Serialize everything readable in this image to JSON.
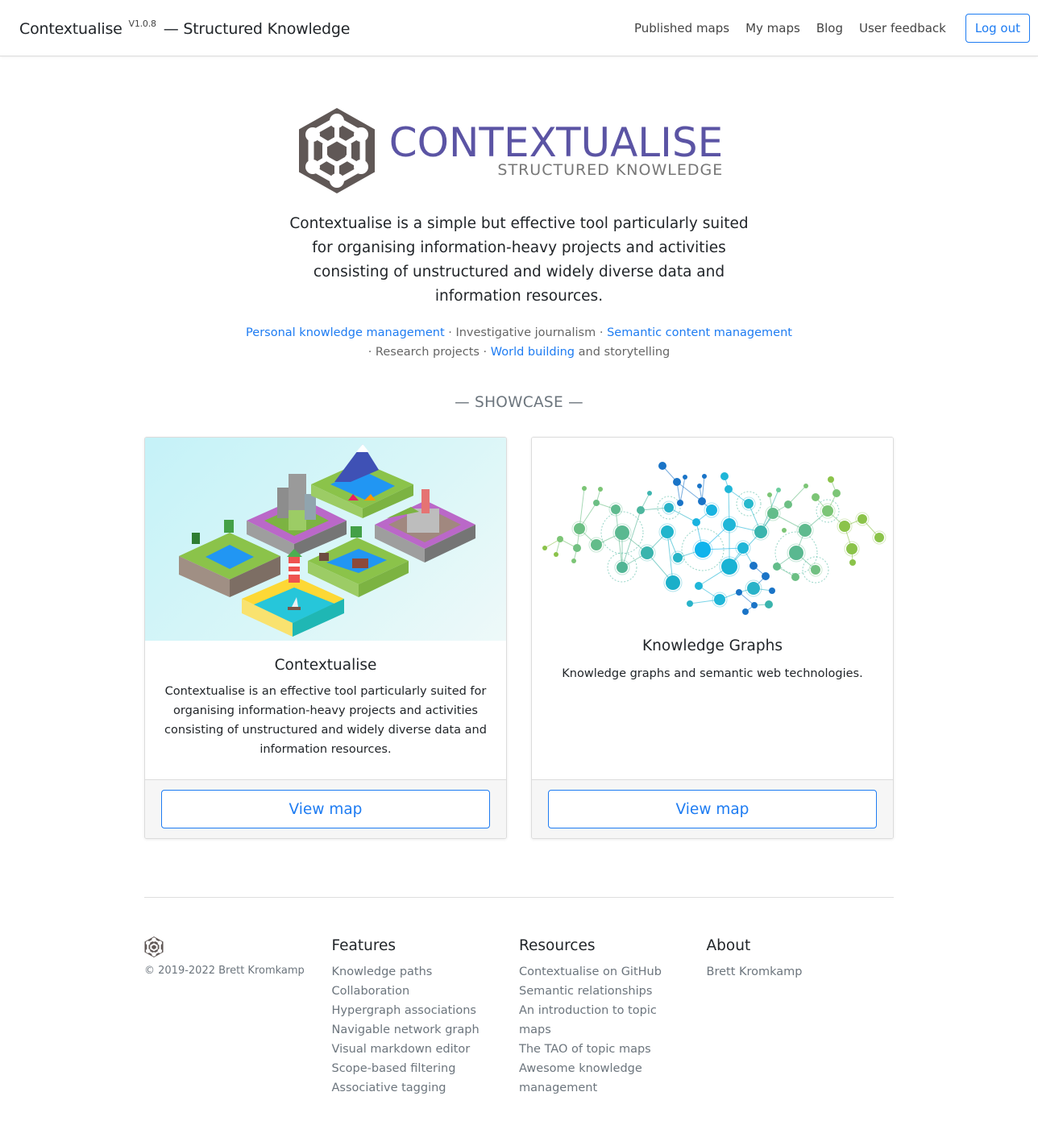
{
  "navbar": {
    "brand_name": "Contextualise",
    "version": "V1.0.8",
    "brand_tagline": "— Structured Knowledge",
    "links": [
      "Published maps",
      "My maps",
      "Blog",
      "User feedback"
    ],
    "logout_label": "Log out"
  },
  "hero": {
    "logo_main": "CONTEXTUALISE",
    "logo_sub": "STRUCTURED KNOWLEDGE",
    "lead": "Contextualise is a simple but effective tool particularly suited for organising information-heavy projects and activities consisting of unstructured and widely diverse data and information resources.",
    "tags": {
      "t1": "Personal knowledge management",
      "s1": " · Investigative journalism · ",
      "t2": "Semantic content management",
      "s2": " · Research projects · ",
      "t3": "World building",
      "s3": " and storytelling"
    },
    "showcase_title": "— SHOWCASE —"
  },
  "cards": [
    {
      "image": "isometric-world-illustration",
      "title": "Contextualise",
      "text": "Contextualise is an effective tool particularly suited for organising information-heavy projects and activities consisting of unstructured and widely diverse data and information resources.",
      "button": "View map"
    },
    {
      "image": "network-graph-illustration",
      "title": "Knowledge Graphs",
      "text": "Knowledge graphs and semantic web technologies.",
      "button": "View map"
    }
  ],
  "footer": {
    "copyright": "© 2019-2022 Brett Kromkamp",
    "features": {
      "heading": "Features",
      "items": [
        "Knowledge paths",
        "Collaboration",
        "Hypergraph associations",
        "Navigable network graph",
        "Visual markdown editor",
        "Scope-based filtering",
        "Associative tagging"
      ]
    },
    "resources": {
      "heading": "Resources",
      "items": [
        "Contextualise on GitHub",
        "Semantic relationships",
        "An introduction to topic maps",
        "The TAO of topic maps",
        "Awesome knowledge management"
      ]
    },
    "about": {
      "heading": "About",
      "items": [
        "Brett Kromkamp"
      ]
    }
  },
  "colors": {
    "accent": "#1e7cf2",
    "logo_purple": "#5b54a4",
    "logo_gray": "#605856"
  }
}
